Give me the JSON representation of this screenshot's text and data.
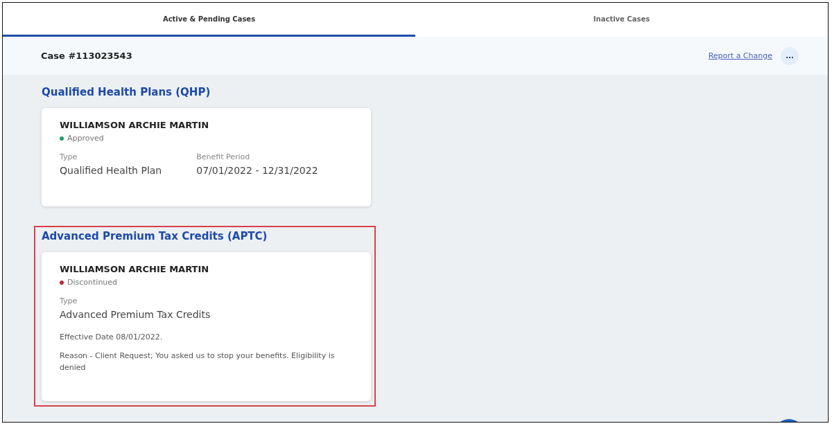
{
  "tabs": [
    {
      "label": "Active & Pending Cases",
      "selected": true
    },
    {
      "label": "Inactive Cases",
      "selected": false
    }
  ],
  "case_header": {
    "title": "Case #113023543",
    "link": "Report a Change",
    "menu_button": "..."
  },
  "sections": [
    {
      "title": "Qualified Health Plans (QHP)",
      "highlighted": false,
      "card": {
        "name": "WILLIAMSON ARCHIE MARTIN",
        "status": {
          "label": "Approved",
          "color": "#1e9e6a"
        },
        "fields": [
          {
            "label": "Type",
            "value": "Qualified Health Plan"
          },
          {
            "label": "Benefit Period",
            "value": "07/01/2022 - 12/31/2022"
          }
        ]
      }
    },
    {
      "title": "Advanced Premium Tax Credits (APTC)",
      "highlighted": true,
      "card": {
        "name": "WILLIAMSON ARCHIE MARTIN",
        "status": {
          "label": "Discontinued",
          "color": "#c0283c"
        },
        "fields": [
          {
            "label": "Type",
            "value": "Advanced Premium Tax Credits"
          }
        ],
        "notes": [
          "Effective Date  08/01/2022.",
          "Reason -  Client Request; You asked us to stop your benefits. Eligibility is denied"
        ]
      }
    }
  ]
}
